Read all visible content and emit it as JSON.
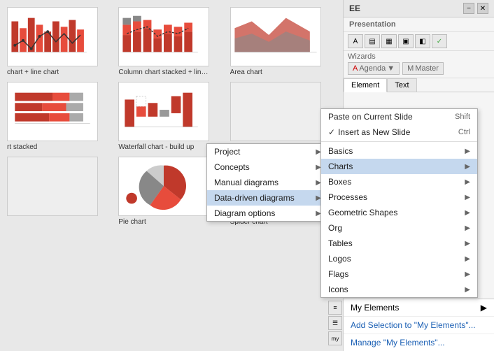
{
  "panel": {
    "title": "EE",
    "section_presentation": "Presentation",
    "section_wizards": "Wizards",
    "tab_element": "Element",
    "tab_text": "Text",
    "agenda_label": "Agenda",
    "master_label": "Master"
  },
  "thumbnails": [
    {
      "label": "chart + line chart",
      "type": "bar-line"
    },
    {
      "label": "Column chart stacked + line...",
      "type": "col-stacked"
    },
    {
      "label": "Area chart",
      "type": "area"
    },
    {
      "label": "rt stacked",
      "type": "bar-stacked"
    },
    {
      "label": "Waterfall chart - build up",
      "type": "waterfall"
    },
    {
      "label": "",
      "type": "empty"
    },
    {
      "label": "",
      "type": "empty2"
    },
    {
      "label": "Pie chart",
      "type": "pie"
    },
    {
      "label": "Spider chart",
      "type": "spider"
    }
  ],
  "context_menu_1": {
    "items": [
      {
        "label": "Project",
        "has_arrow": true
      },
      {
        "label": "Concepts",
        "has_arrow": true
      },
      {
        "label": "Manual diagrams",
        "has_arrow": true
      },
      {
        "label": "Data-driven diagrams",
        "has_arrow": true,
        "highlighted": true
      },
      {
        "label": "Diagram options",
        "has_arrow": true
      }
    ]
  },
  "context_menu_2": {
    "items": [
      {
        "label": "Paste on Current Slide",
        "shortcut": "Shift",
        "has_check": false
      },
      {
        "label": "Insert as New Slide",
        "shortcut": "Ctrl",
        "has_check": true
      },
      {
        "label": "Basics",
        "has_arrow": true
      },
      {
        "label": "Charts",
        "has_arrow": true,
        "highlighted": true
      },
      {
        "label": "Boxes",
        "has_arrow": true
      },
      {
        "label": "Processes",
        "has_arrow": true
      },
      {
        "label": "Geometric Shapes",
        "has_arrow": true
      },
      {
        "label": "Org",
        "has_arrow": true
      },
      {
        "label": "Tables",
        "has_arrow": true
      },
      {
        "label": "Logos",
        "has_arrow": true
      },
      {
        "label": "Flags",
        "has_arrow": true
      },
      {
        "label": "Icons",
        "has_arrow": true
      }
    ]
  },
  "bottom_menu": {
    "my_elements": "My Elements",
    "add_selection": "Add Selection to \"My Elements\"...",
    "manage": "Manage \"My Elements\"..."
  }
}
